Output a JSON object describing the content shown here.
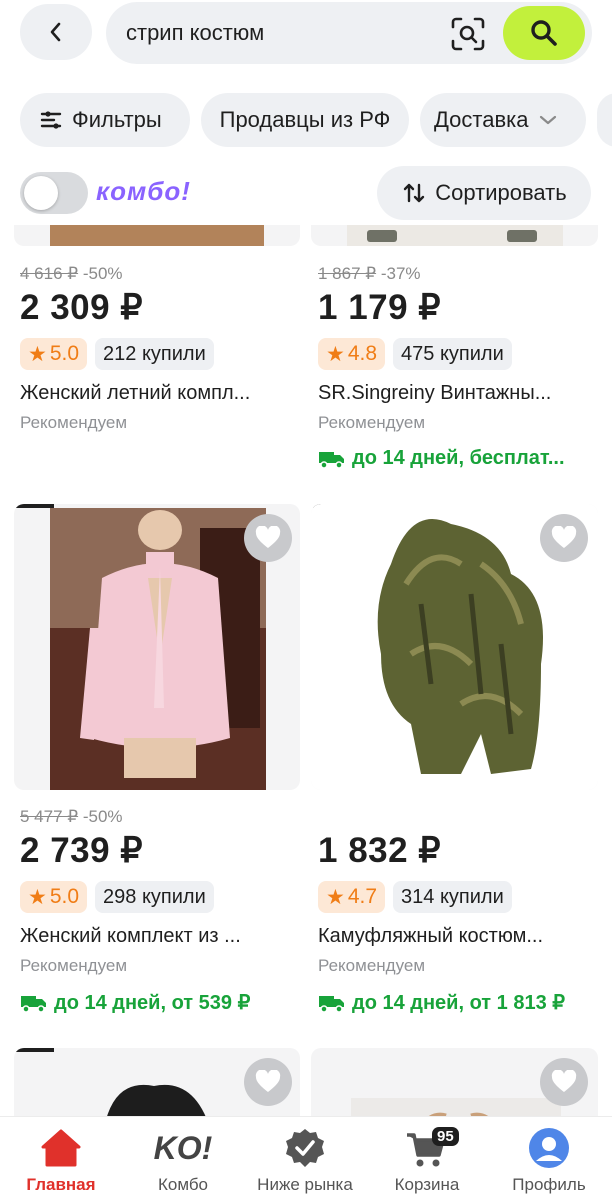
{
  "search": {
    "query": "стрип костюм"
  },
  "filters": {
    "filters_label": "Фильтры",
    "sellers_label": "Продавцы из РФ",
    "delivery_label": "Доставка",
    "kombo_label": "комбо!",
    "sort_label": "Сортировать"
  },
  "products": [
    {
      "old_price": "4 616 ₽",
      "discount": "-50%",
      "price": "2 309 ₽",
      "rating": "5.0",
      "bought": "212 купили",
      "title": "Женский летний компл...",
      "recommend": "Рекомендуем",
      "delivery": ""
    },
    {
      "old_price": "1 867 ₽",
      "discount": "-37%",
      "price": "1 179 ₽",
      "rating": "4.8",
      "bought": "475 купили",
      "title": "SR.Singreiny Винтажны...",
      "recommend": "Рекомендуем",
      "delivery": "до 14 дней, бесплат..."
    },
    {
      "old_price": "5 477 ₽",
      "discount": "-50%",
      "price": "2 739 ₽",
      "rating": "5.0",
      "bought": "298 купили",
      "title": "Женский комплект из ...",
      "recommend": "Рекомендуем",
      "delivery": "до 14 дней, от 539 ₽"
    },
    {
      "old_price": "",
      "discount": "",
      "price": "1 832 ₽",
      "rating": "4.7",
      "bought": "314 купили",
      "title": "Камуфляжный костюм...",
      "recommend": "Рекомендуем",
      "delivery": "до 14 дней, от 1 813 ₽"
    }
  ],
  "nav": {
    "home": "Главная",
    "kombo": "Комбо",
    "kombo_logo": "KO!",
    "below_market": "Ниже рынка",
    "cart": "Корзина",
    "cart_count": "95",
    "profile": "Профиль"
  },
  "colors": {
    "accent": "#c2f03c",
    "delivery_green": "#18a33a",
    "rating_orange": "#f07d16",
    "active_red": "#e0312b",
    "kombo_purple": "#8a63ff"
  }
}
